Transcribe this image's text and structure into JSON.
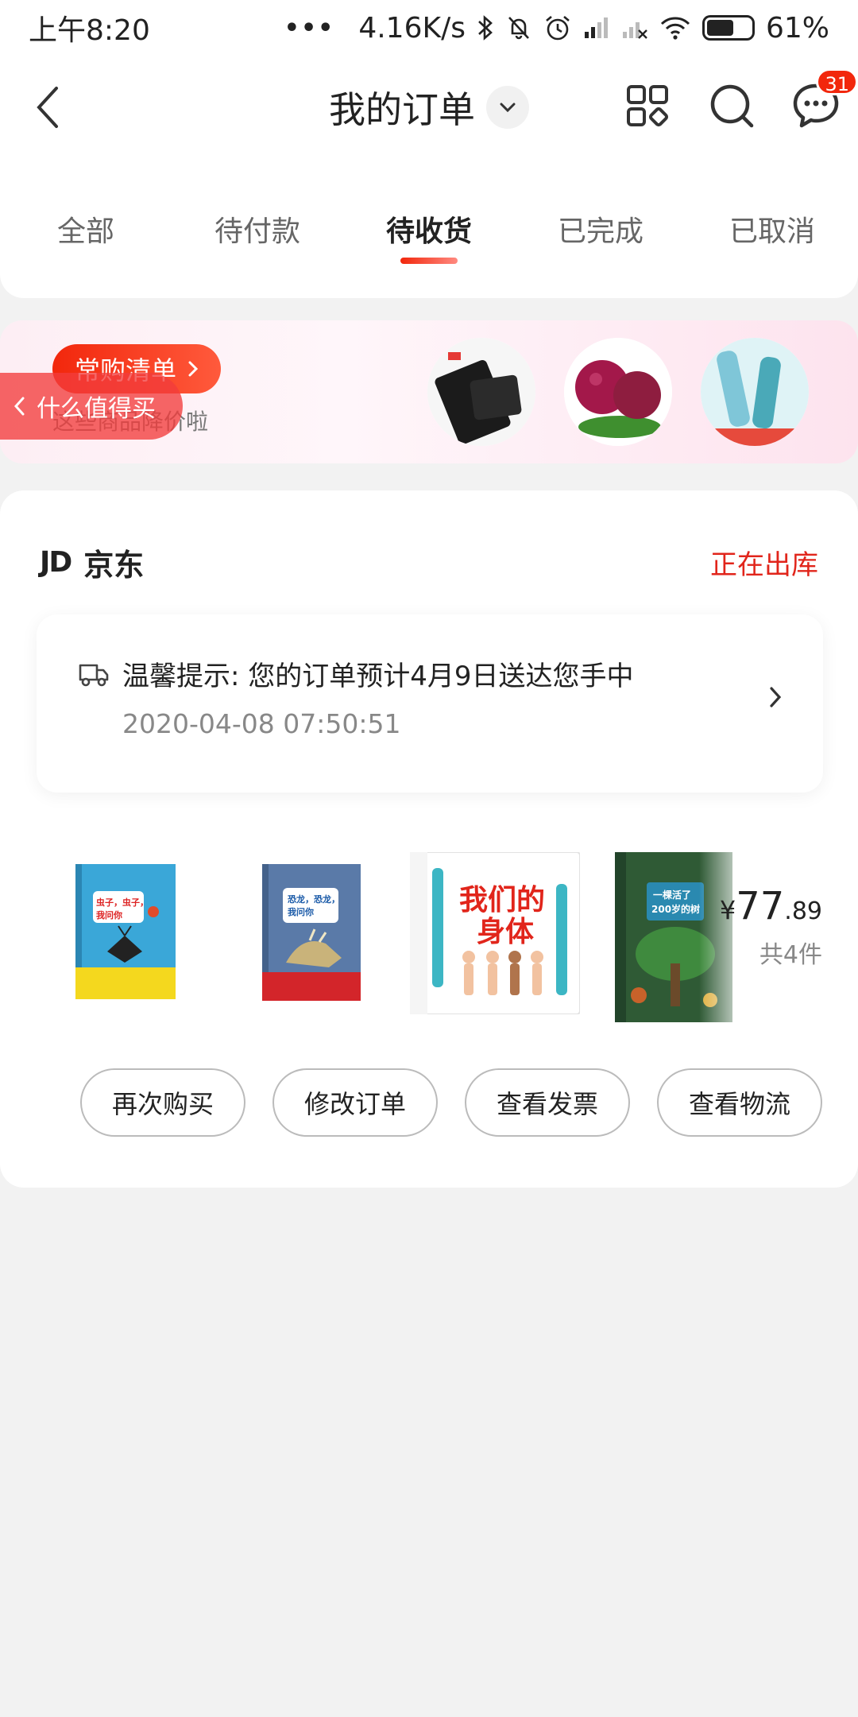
{
  "status_bar": {
    "time": "上午8:20",
    "dots": "•••",
    "speed": "4.16K/s",
    "battery": "61%"
  },
  "header": {
    "title": "我的订单",
    "message_badge": "31"
  },
  "tabs": [
    {
      "label": "全部"
    },
    {
      "label": "待付款"
    },
    {
      "label": "待收货"
    },
    {
      "label": "已完成"
    },
    {
      "label": "已取消"
    }
  ],
  "banner": {
    "pill_label": "常购清单",
    "subtitle": "这些商品降价啦",
    "float_label": "什么值得买"
  },
  "order": {
    "shop_logo": "JD",
    "shop_name": "京东",
    "status": "正在出库",
    "notice_text": "温馨提示: 您的订单预计4月9日送达您手中",
    "notice_time": "2020-04-08 07:50:51",
    "books": [
      {
        "title": "虫子，虫子，我问你"
      },
      {
        "title": "恐龙，恐龙，我问你"
      },
      {
        "title": "我们的身体"
      },
      {
        "title": "一棵活了200岁的树"
      }
    ],
    "price_yen": "¥",
    "price_int": "77",
    "price_dec": ".89",
    "count": "共4件",
    "actions": {
      "rebuy": "再次购买",
      "modify": "修改订单",
      "invoice": "查看发票",
      "logistics": "查看物流"
    }
  },
  "colors": {
    "accent": "#f2270c",
    "status_red": "#e1251b",
    "background": "#f2f2f2"
  }
}
